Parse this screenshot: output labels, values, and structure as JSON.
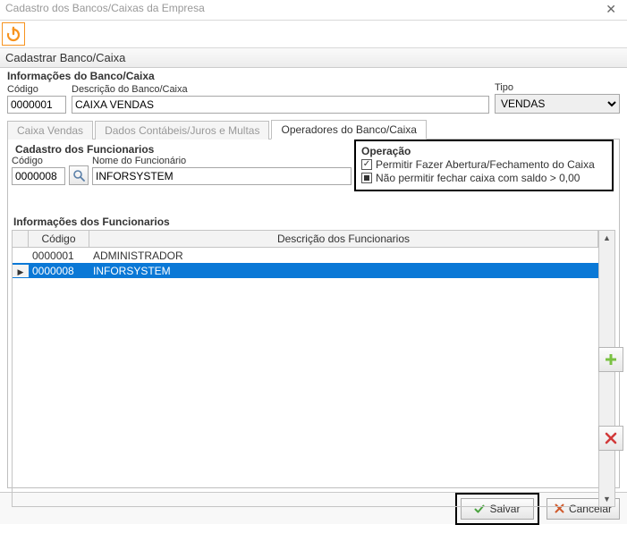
{
  "window": {
    "title": "Cadastro dos Bancos/Caixas da Empresa"
  },
  "section": {
    "cadastrar": "Cadastrar Banco/Caixa",
    "info_banco": "Informações do Banco/Caixa"
  },
  "fields": {
    "codigo_label": "Código",
    "codigo_value": "0000001",
    "descricao_label": "Descrição do Banco/Caixa",
    "descricao_value": "CAIXA VENDAS",
    "tipo_label": "Tipo",
    "tipo_value": "VENDAS"
  },
  "tabs": {
    "caixa_vendas": "Caixa Vendas",
    "dados_contabeis": "Dados Contábeis/Juros e Multas",
    "operadores": "Operadores do Banco/Caixa"
  },
  "cad_func": {
    "title": "Cadastro dos Funcionarios",
    "codigo_label": "Código",
    "codigo_value": "0000008",
    "nome_label": "Nome do Funcionário",
    "nome_value": "INFORSYSTEM"
  },
  "operacao": {
    "title": "Operação",
    "permitir": "Permitir Fazer Abertura/Fechamento do Caixa",
    "nao_permitir": "Não permitir fechar caixa com saldo > 0,00"
  },
  "grid": {
    "title": "Informações dos Funcionarios",
    "col_codigo": "Código",
    "col_desc": "Descrição dos Funcionarios",
    "rows": [
      {
        "codigo": "0000001",
        "desc": "ADMINISTRADOR",
        "selected": false
      },
      {
        "codigo": "0000008",
        "desc": "INFORSYSTEM",
        "selected": true
      }
    ]
  },
  "footer": {
    "salvar": "Salvar",
    "cancelar": "Cancelar"
  }
}
